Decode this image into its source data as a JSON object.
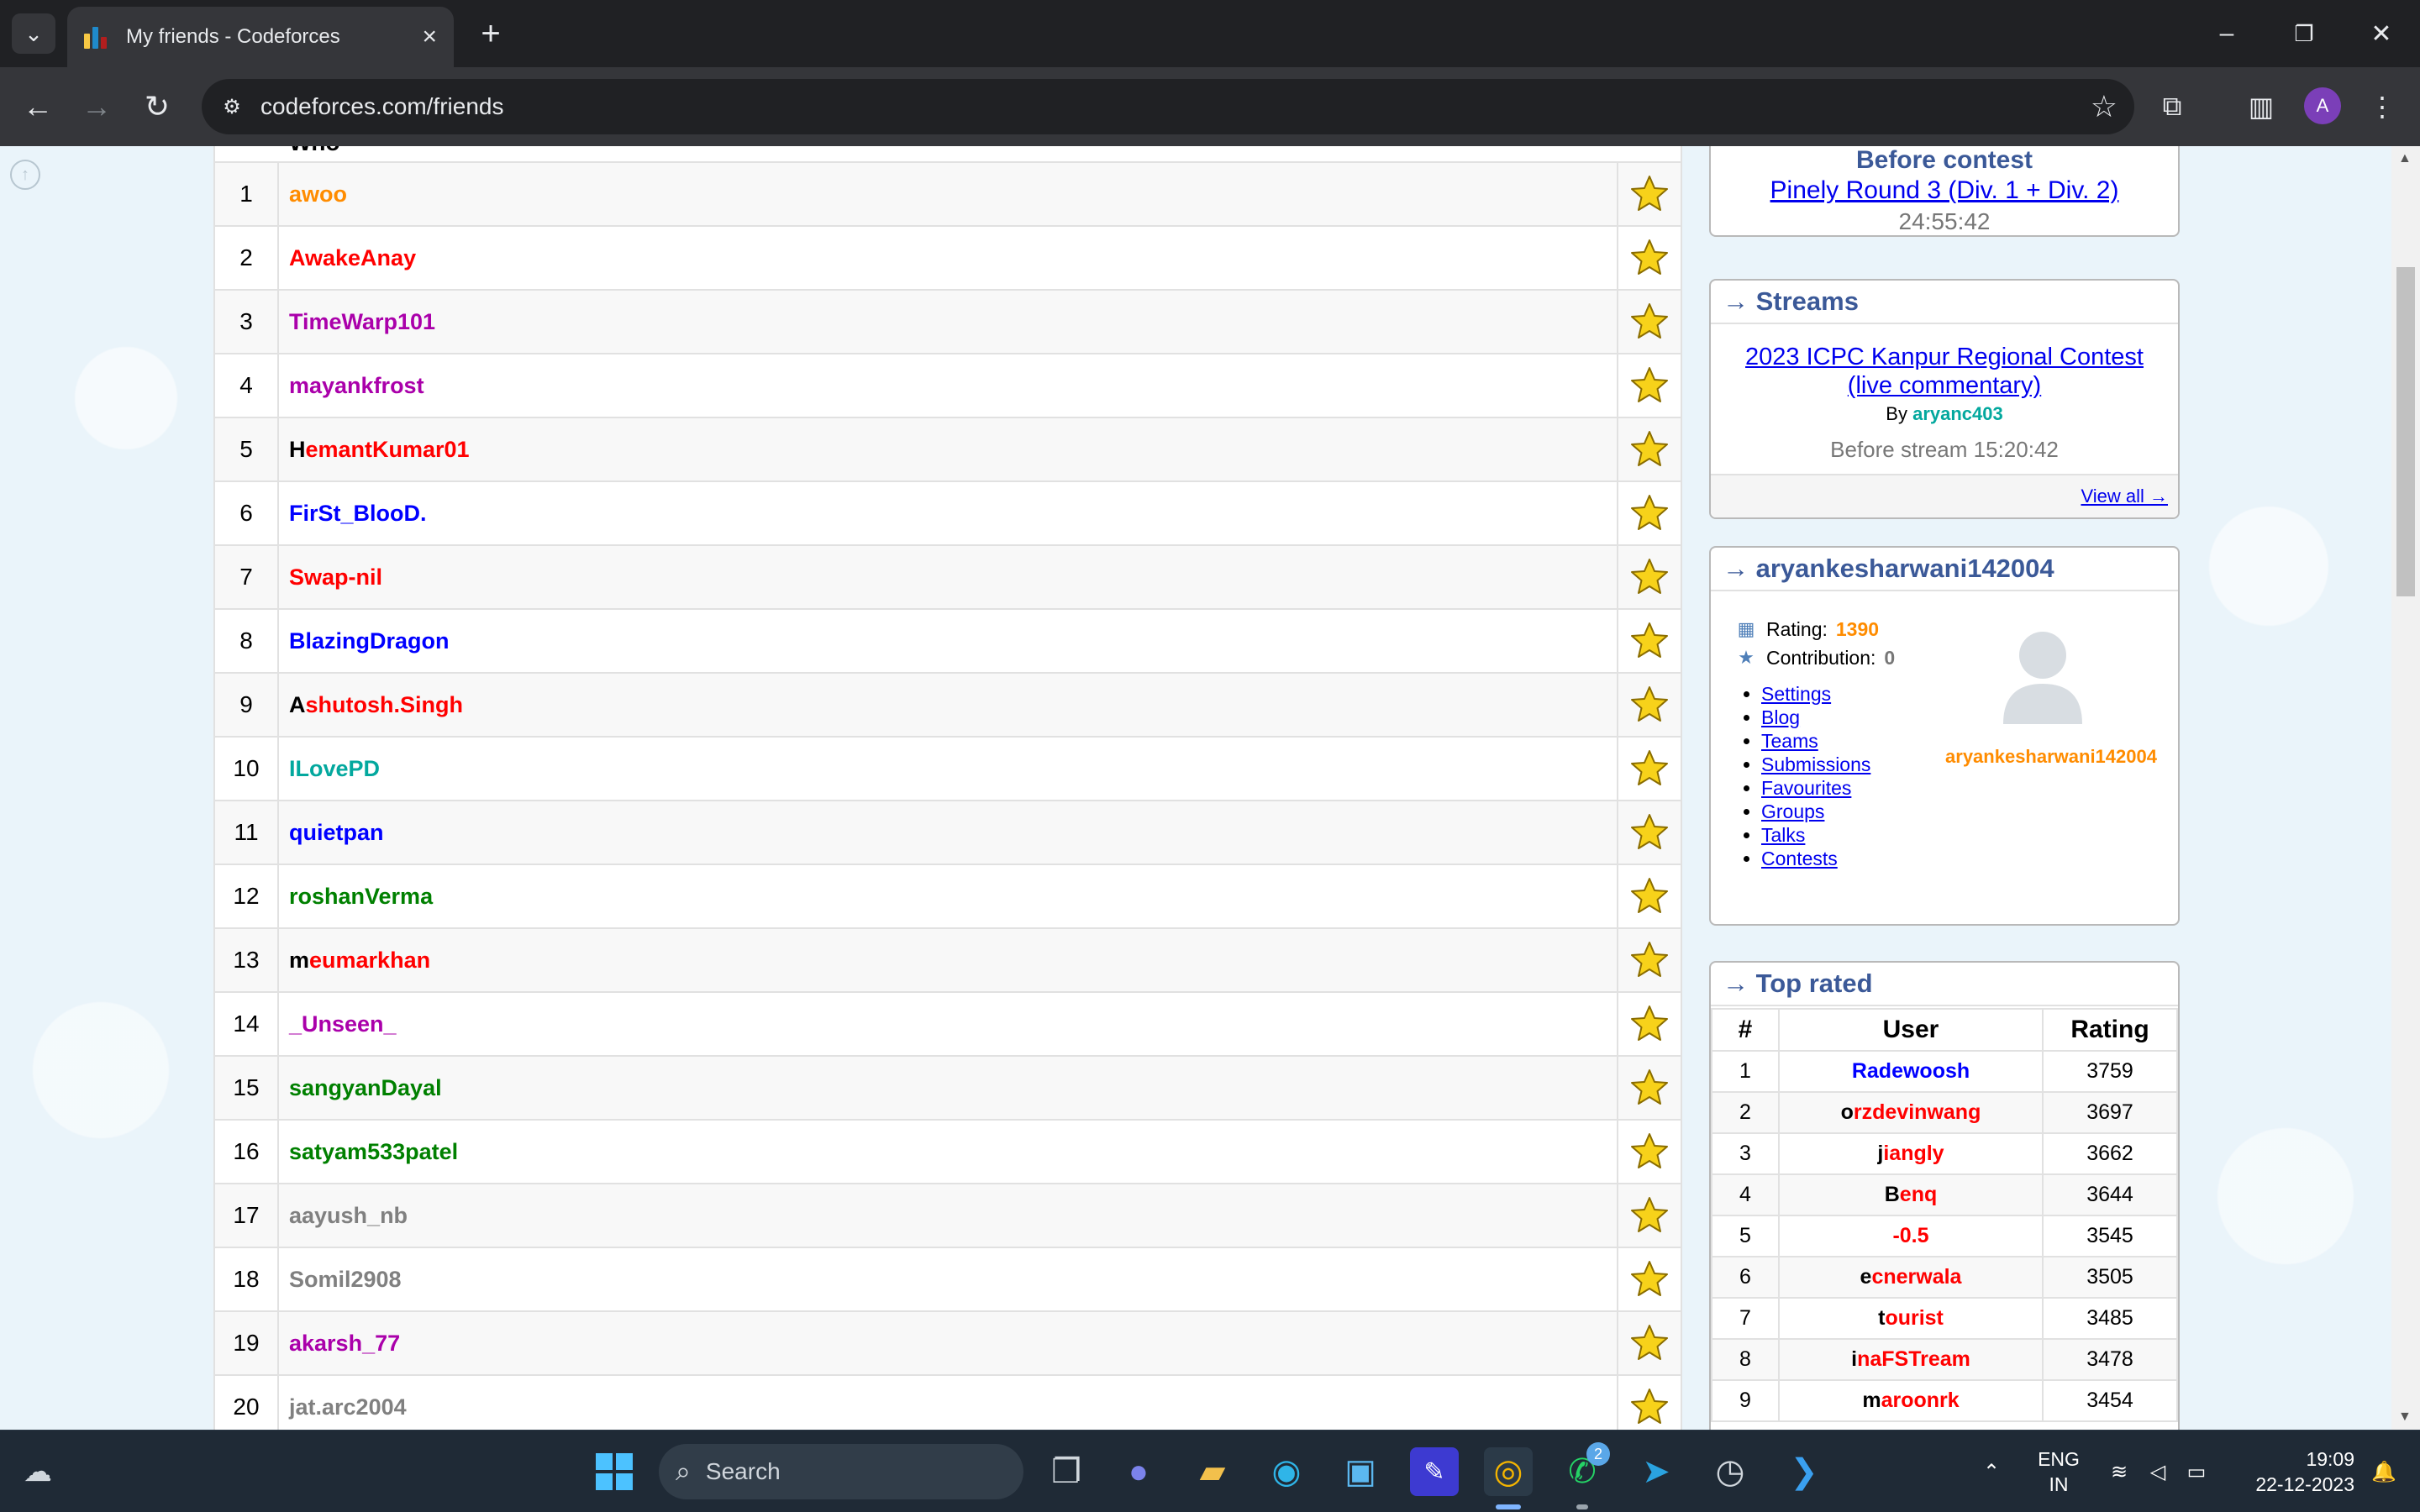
{
  "browser": {
    "tab_title": "My friends - Codeforces",
    "url": "codeforces.com/friends",
    "profile_initial": "A"
  },
  "friends": {
    "column_who": "Who",
    "rows": [
      {
        "num": "1",
        "handle": "awoo",
        "color": "orange"
      },
      {
        "num": "2",
        "handle": "AwakeAnay",
        "color": "red"
      },
      {
        "num": "3",
        "handle": "TimeWarp101",
        "color": "violet"
      },
      {
        "num": "4",
        "handle": "mayankfrost",
        "color": "violet"
      },
      {
        "num": "5",
        "handle": "HemantKumar01",
        "color": "red",
        "first_black": true
      },
      {
        "num": "6",
        "handle": "FirSt_BlooD.",
        "color": "blue"
      },
      {
        "num": "7",
        "handle": "Swap-nil",
        "color": "red"
      },
      {
        "num": "8",
        "handle": "BlazingDragon",
        "color": "blue"
      },
      {
        "num": "9",
        "handle": "Ashutosh.Singh",
        "color": "red",
        "first_black": true
      },
      {
        "num": "10",
        "handle": "ILovePD",
        "color": "cyan"
      },
      {
        "num": "11",
        "handle": "quietpan",
        "color": "blue"
      },
      {
        "num": "12",
        "handle": "roshanVerma",
        "color": "green"
      },
      {
        "num": "13",
        "handle": "meumarkhan",
        "color": "red",
        "first_black": true
      },
      {
        "num": "14",
        "handle": "_Unseen_",
        "color": "violet"
      },
      {
        "num": "15",
        "handle": "sangyanDayal",
        "color": "green"
      },
      {
        "num": "16",
        "handle": "satyam533patel",
        "color": "green"
      },
      {
        "num": "17",
        "handle": "aayush_nb",
        "color": "gray"
      },
      {
        "num": "18",
        "handle": "Somil2908",
        "color": "gray"
      },
      {
        "num": "19",
        "handle": "akarsh_77",
        "color": "violet"
      },
      {
        "num": "20",
        "handle": "jat.arc2004",
        "color": "gray"
      }
    ]
  },
  "contest_box": {
    "label": "Before contest",
    "contest_name": "Pinely Round 3 (Div. 1 + Div. 2)",
    "countdown": "24:55:42"
  },
  "streams": {
    "title": "→ Streams",
    "stream_name": "2023 ICPC Kanpur Regional Contest (live commentary)",
    "by_label": "By",
    "by_user": "aryanc403",
    "before_stream": "Before stream 15:20:42",
    "view_all": "View all →"
  },
  "user_box": {
    "title": "→ aryankesharwani142004",
    "rating_label": "Rating:",
    "rating_value": "1390",
    "contribution_label": "Contribution:",
    "contribution_value": "0",
    "links": [
      "Settings",
      "Blog",
      "Teams",
      "Submissions",
      "Favourites",
      "Groups",
      "Talks",
      "Contests"
    ],
    "avatar_name": "aryankesharwani142004"
  },
  "top_rated": {
    "title": "→ Top rated",
    "headers": [
      "#",
      "User",
      "Rating"
    ],
    "rows": [
      {
        "num": "1",
        "user": "Radewoosh",
        "rating": "3759",
        "color": "blue"
      },
      {
        "num": "2",
        "user": "orzdevinwang",
        "rating": "3697",
        "color": "red",
        "first_black": true
      },
      {
        "num": "3",
        "user": "jiangly",
        "rating": "3662",
        "color": "red",
        "first_black": true
      },
      {
        "num": "4",
        "user": "Benq",
        "rating": "3644",
        "color": "red",
        "first_black": true
      },
      {
        "num": "5",
        "user": "-0.5",
        "rating": "3545",
        "color": "red"
      },
      {
        "num": "6",
        "user": "ecnerwala",
        "rating": "3505",
        "color": "red",
        "first_black": true
      },
      {
        "num": "7",
        "user": "tourist",
        "rating": "3485",
        "color": "red",
        "first_black": true
      },
      {
        "num": "8",
        "user": "inaFSTream",
        "rating": "3478",
        "color": "red",
        "first_black": true
      },
      {
        "num": "9",
        "user": "maroonrk",
        "rating": "3454",
        "color": "red",
        "first_black": true
      }
    ]
  },
  "taskbar": {
    "search_placeholder": "Search",
    "whatsapp_badge": "2",
    "lang_line1": "ENG",
    "lang_line2": "IN",
    "time": "19:09",
    "date": "22-12-2023"
  },
  "colors": {
    "orange": "#ff8c00",
    "red": "#ff0000",
    "violet": "#aa00aa",
    "blue": "#0000ff",
    "cyan": "#03a89e",
    "green": "#008000",
    "gray": "#808080",
    "header_blue": "#3b5998"
  },
  "icons": {
    "star": "star-icon",
    "rating": "rating-icon",
    "contribution": "contribution-icon"
  }
}
